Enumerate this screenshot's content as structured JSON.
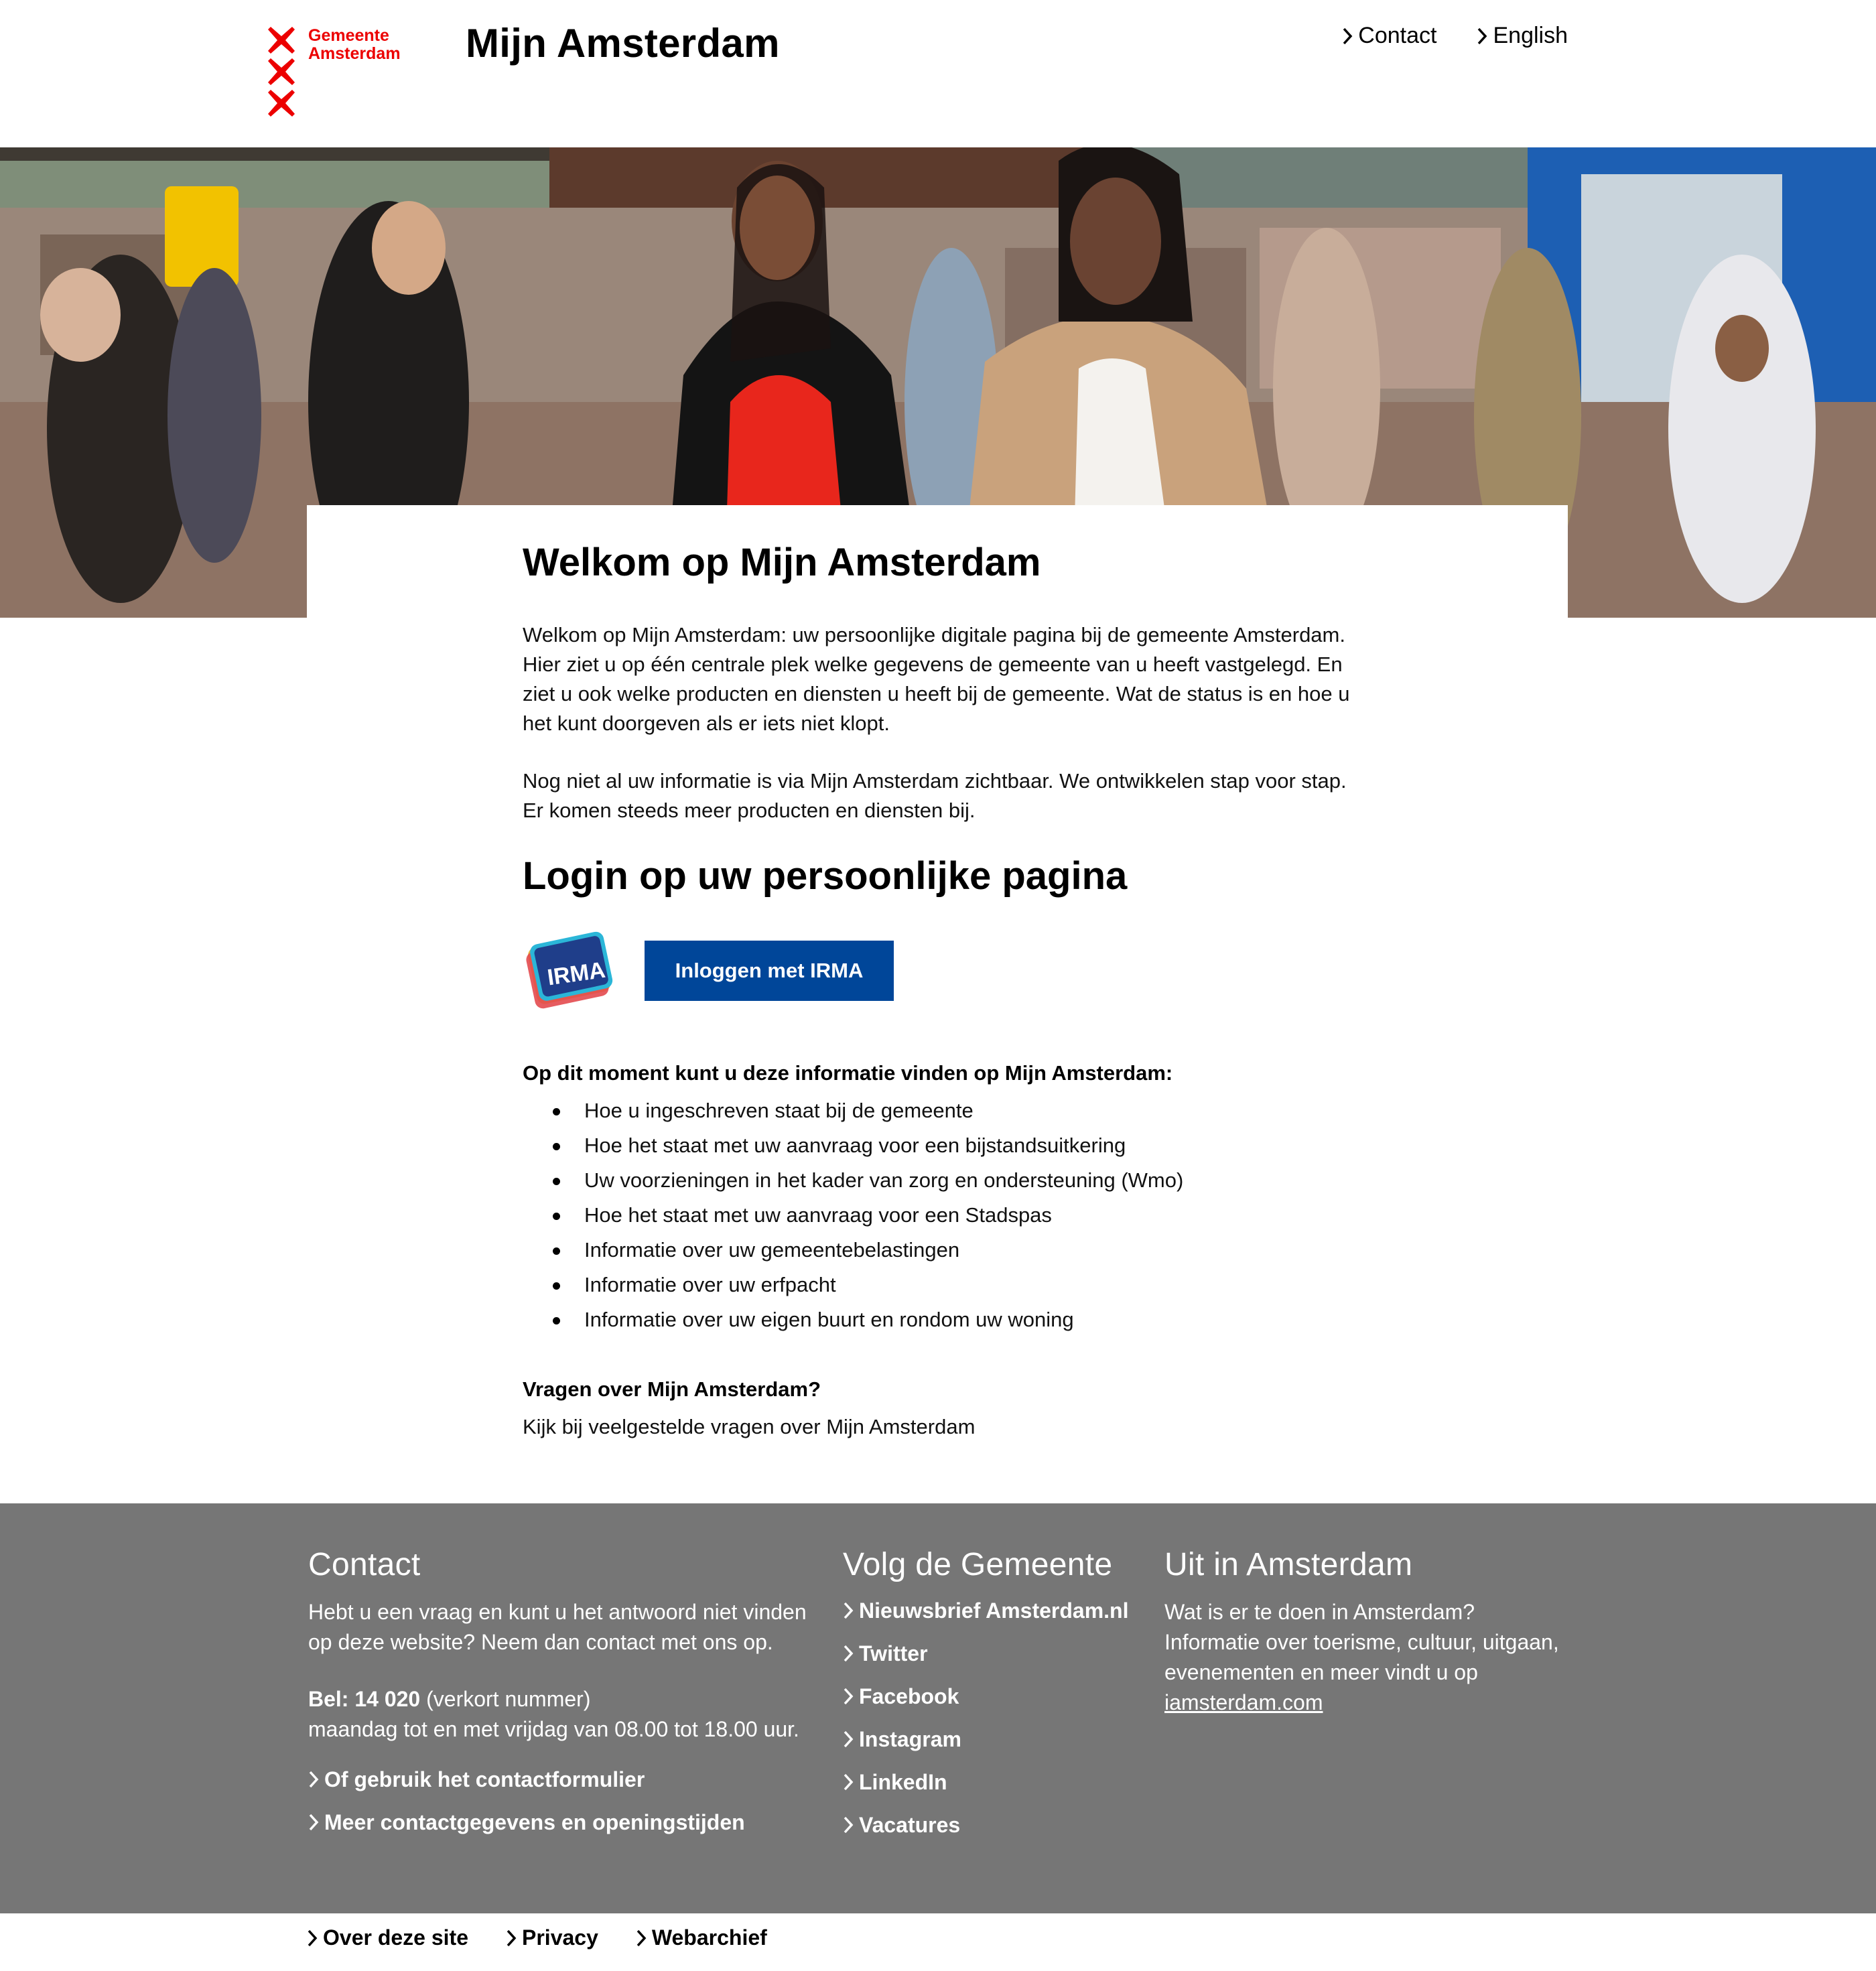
{
  "header": {
    "logo_text_line1": "Gemeente",
    "logo_text_line2": "Amsterdam",
    "site_title": "Mijn Amsterdam",
    "links": [
      {
        "label": "Contact"
      },
      {
        "label": "English"
      }
    ]
  },
  "main": {
    "title": "Welkom op Mijn Amsterdam",
    "intro_paragraphs": [
      "Welkom op Mijn Amsterdam: uw persoonlijke digitale pagina bij de gemeente Amsterdam. Hier ziet u op één centrale plek welke gegevens de gemeente van u heeft vastgelegd. En ziet u ook welke producten en diensten u heeft bij de gemeente. Wat de status is en hoe u het kunt doorgeven als er iets niet klopt.",
      "Nog niet al uw informatie is via Mijn Amsterdam zichtbaar. We ontwikkelen stap voor stap. Er komen steeds meer producten en diensten bij."
    ],
    "login_title": "Login op uw persoonlijke pagina",
    "irma_logo_text": "IRMA",
    "login_button": "Inloggen met IRMA",
    "info_title": "Op dit moment kunt u deze informatie vinden op Mijn Amsterdam:",
    "info_items": [
      "Hoe u ingeschreven staat bij de gemeente",
      "Hoe het staat met uw aanvraag voor een bijstandsuitkering",
      "Uw voorzieningen in het kader van zorg en ondersteuning (Wmo)",
      "Hoe het staat met uw aanvraag voor een Stadspas",
      "Informatie over uw gemeentebelastingen",
      "Informatie over uw erfpacht",
      "Informatie over uw eigen buurt en rondom uw woning"
    ],
    "faq_title": "Vragen over Mijn Amsterdam?",
    "faq_link": "Kijk bij veelgestelde vragen over Mijn Amsterdam"
  },
  "footer": {
    "contact": {
      "title": "Contact",
      "text": "Hebt u een vraag en kunt u het antwoord niet vinden op deze website? Neem dan contact met ons op.",
      "phone_label": "Bel: 14 020",
      "phone_note": " (verkort nummer)",
      "hours": "maandag tot en met vrijdag van 08.00 tot 18.00 uur.",
      "links": [
        "Of gebruik het contactformulier",
        "Meer contactgegevens en openingstijden"
      ]
    },
    "volg": {
      "title": "Volg de Gemeente",
      "links": [
        "Nieuwsbrief Amsterdam.nl",
        "Twitter",
        "Facebook",
        "Instagram",
        "LinkedIn",
        "Vacatures"
      ]
    },
    "uit": {
      "title": "Uit in Amsterdam",
      "text": "Wat is er te doen in Amsterdam? Informatie over toerisme, cultuur, uitgaan, evenementen en meer vindt u op ",
      "link": "iamsterdam.com"
    },
    "bottom_links": [
      "Over deze site",
      "Privacy",
      "Webarchief"
    ]
  },
  "colors": {
    "brand_red": "#ec0000",
    "button_blue": "#004699",
    "footer_gray": "#767676"
  }
}
